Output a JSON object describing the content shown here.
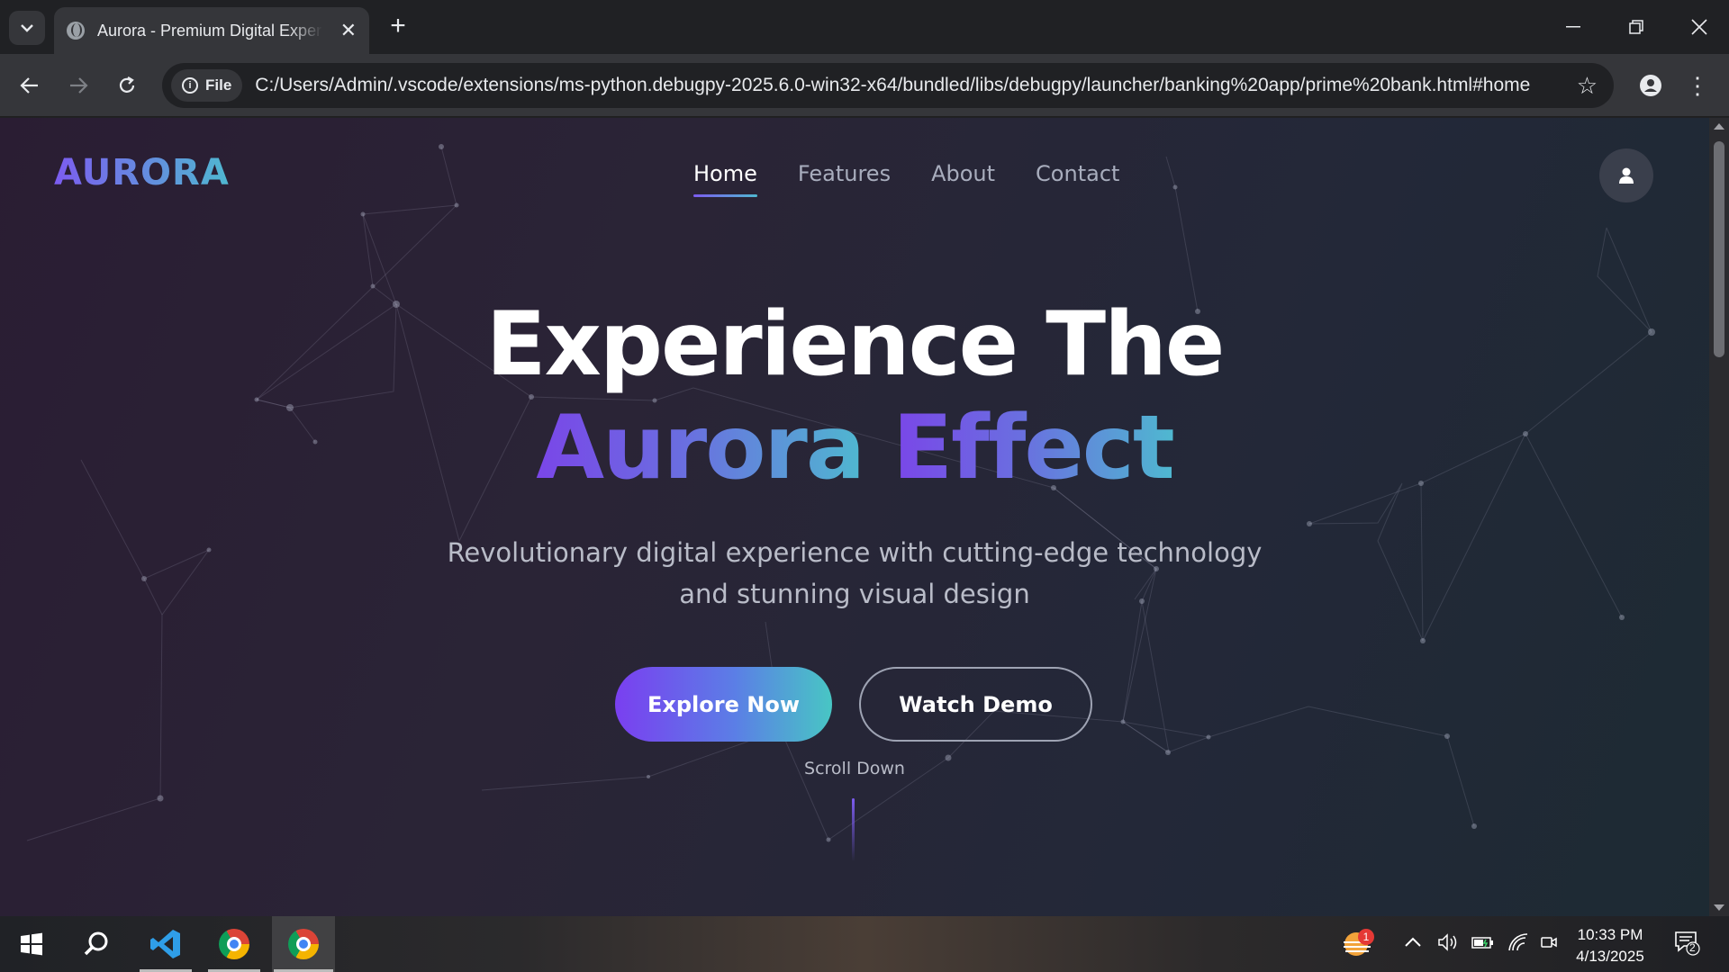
{
  "browser": {
    "tab_title": "Aurora - Premium Digital Experience",
    "address_chip": "File",
    "url": "C:/Users/Admin/.vscode/extensions/ms-python.debugpy-2025.6.0-win32-x64/bundled/libs/debugpy/launcher/banking%20app/prime%20bank.html#home",
    "icons": [
      "tab-search-icon",
      "globe-icon",
      "close-icon",
      "plus-icon",
      "minimize-icon",
      "restore-icon",
      "close-window-icon",
      "back-arrow-icon",
      "forward-arrow-icon",
      "reload-icon",
      "info-icon",
      "star-icon",
      "profile-icon",
      "menu-icon"
    ]
  },
  "site": {
    "logo": "AURORA",
    "nav": [
      {
        "label": "Home",
        "active": true
      },
      {
        "label": "Features",
        "active": false
      },
      {
        "label": "About",
        "active": false
      },
      {
        "label": "Contact",
        "active": false
      }
    ],
    "user_icon": "user-icon",
    "hero": {
      "line1": "Experience The",
      "line2_a": "Aurora",
      "line2_b": "Effect",
      "subtitle_1": "Revolutionary digital experience with cutting-edge technology",
      "subtitle_2": "and stunning visual design",
      "primary_button": "Explore Now",
      "secondary_button": "Watch Demo",
      "scroll_label": "Scroll Down"
    },
    "colors": {
      "accent_purple": "#7a3ff0",
      "accent_teal": "#48c6c4",
      "background": "#262838"
    }
  },
  "taskbar": {
    "apps": [
      "windows-start-icon",
      "search-icon",
      "vscode-icon",
      "chrome-icon",
      "chrome-icon"
    ],
    "weather_badge": "1",
    "time": "10:33 PM",
    "date": "4/13/2025",
    "notification_count": "2"
  }
}
